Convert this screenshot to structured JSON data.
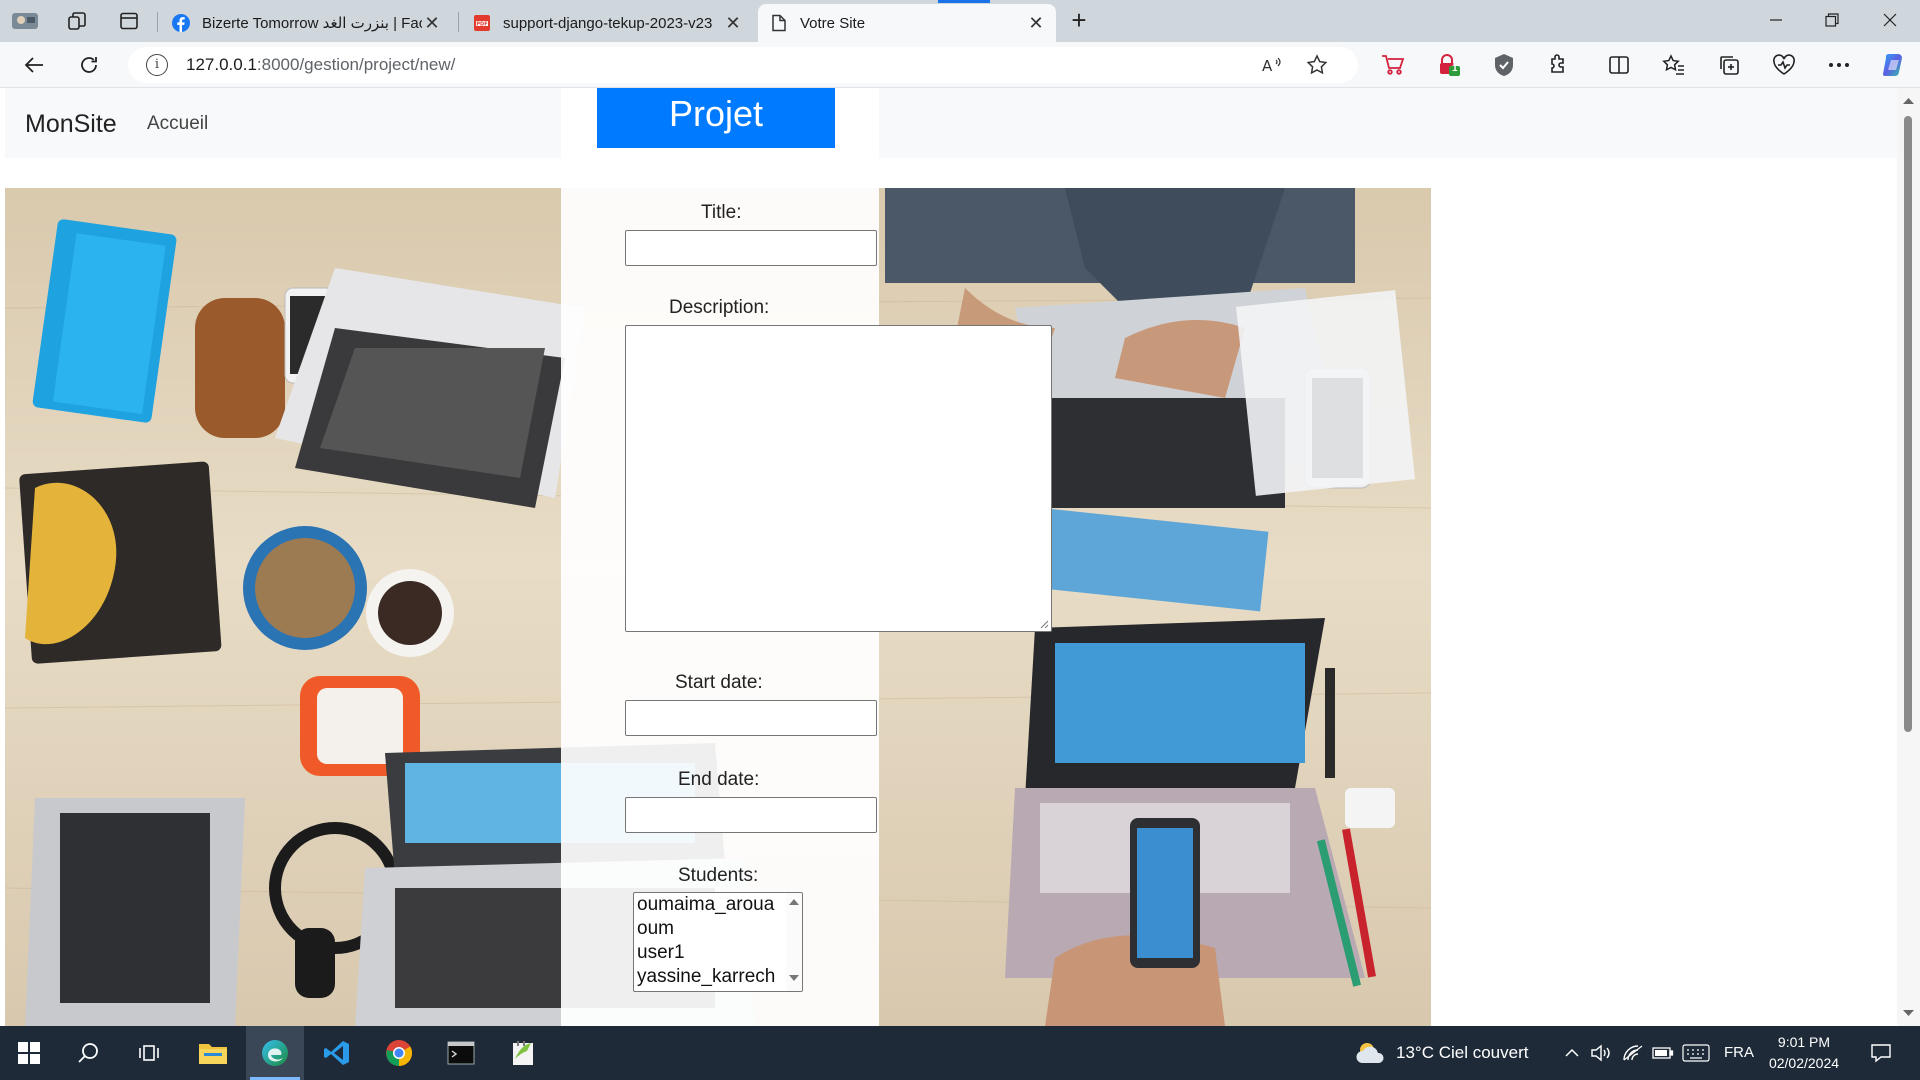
{
  "browser": {
    "tabs": [
      {
        "label": "Bizerte Tomorrow بنزرت الغد | Fac",
        "favicon": "facebook-icon"
      },
      {
        "label": "support-django-tekup-2023-v23",
        "favicon": "pdf-icon"
      },
      {
        "label": "Votre Site",
        "favicon": "page-icon"
      }
    ],
    "url_host": "127.0.0.1",
    "url_path": ":8000/gestion/project/new/",
    "extension_badge": "1"
  },
  "site": {
    "brand": "MonSite",
    "nav_home": "Accueil"
  },
  "form": {
    "heading": "Projet",
    "title_label": "Title:",
    "title_value": "",
    "description_label": "Description:",
    "description_value": "",
    "start_label": "Start date:",
    "start_value": "",
    "end_label": "End date:",
    "end_value": "",
    "students_label": "Students:",
    "students_options": [
      "oumaima_aroua",
      "oum",
      "user1",
      "yassine_karrech"
    ]
  },
  "taskbar": {
    "weather": "13°C  Ciel couvert",
    "lang": "FRA",
    "time": "9:01 PM",
    "date": "02/02/2024"
  },
  "colors": {
    "accent": "#007bff",
    "taskbar": "#1e2a38",
    "tabstrip": "#cfd6dc"
  }
}
